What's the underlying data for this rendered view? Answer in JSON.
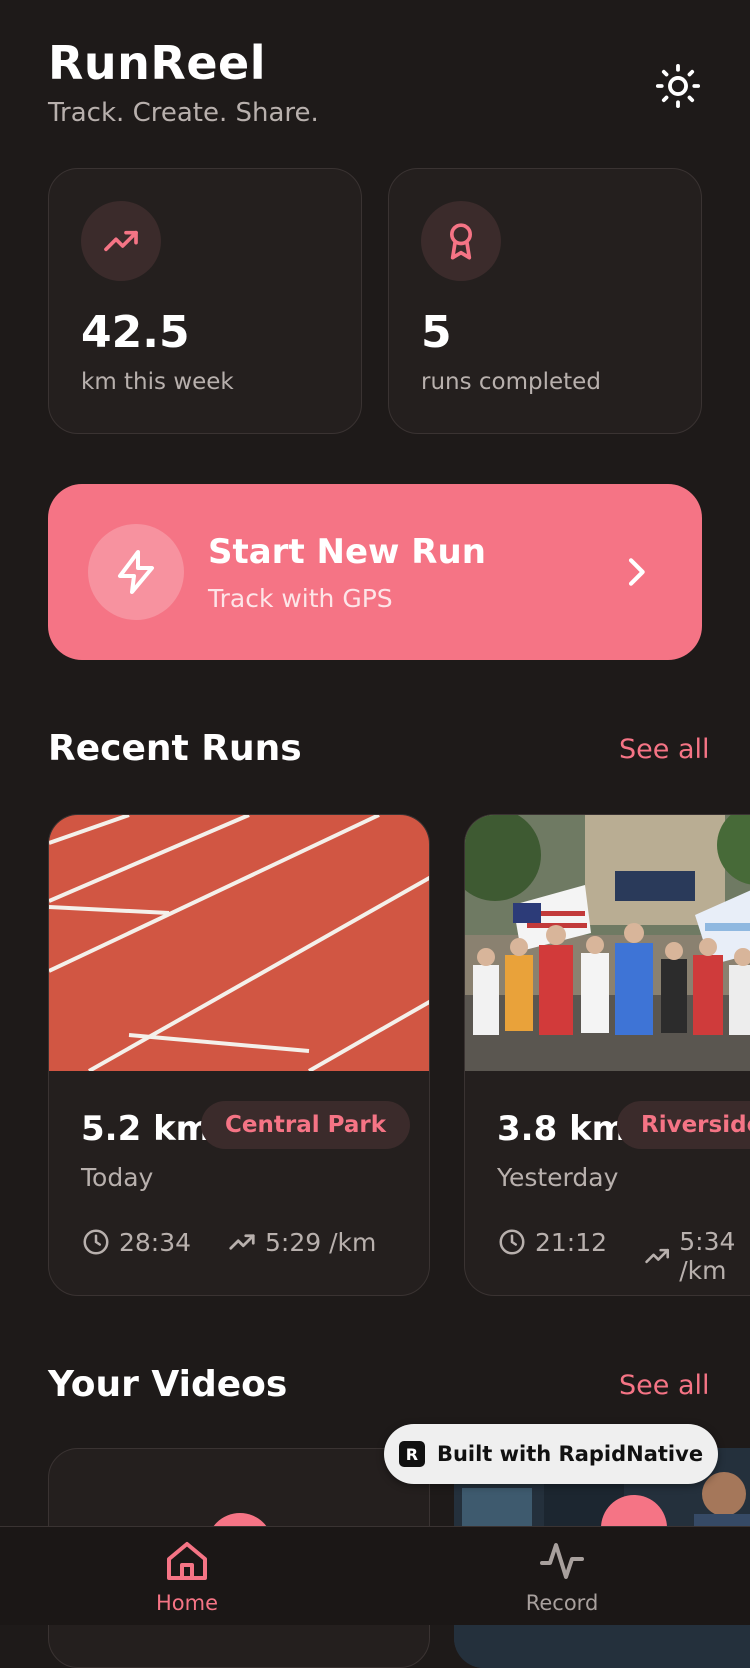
{
  "header": {
    "title": "RunReel",
    "subtitle": "Track. Create. Share."
  },
  "stats": [
    {
      "value": "42.5",
      "label": "km this week",
      "icon": "trending-up-icon"
    },
    {
      "value": "5",
      "label": "runs completed",
      "icon": "award-icon"
    }
  ],
  "start_run": {
    "title": "Start New Run",
    "subtitle": "Track with GPS"
  },
  "recent_runs": {
    "title": "Recent Runs",
    "see_all": "See all",
    "items": [
      {
        "distance": "5.2 km",
        "location": "Central Park",
        "when": "Today",
        "duration": "28:34",
        "pace": "5:29 /km"
      },
      {
        "distance": "3.8 km",
        "location": "Riverside",
        "when": "Yesterday",
        "duration": "21:12",
        "pace": "5:34 /km"
      }
    ]
  },
  "videos": {
    "title": "Your Videos",
    "see_all": "See all"
  },
  "badge": {
    "text": "Built with RapidNative"
  },
  "tabs": [
    {
      "label": "Home",
      "active": true
    },
    {
      "label": "Record",
      "active": false
    }
  ],
  "colors": {
    "accent": "#f57485",
    "background": "#1e1a19",
    "card": "#241f1e"
  }
}
